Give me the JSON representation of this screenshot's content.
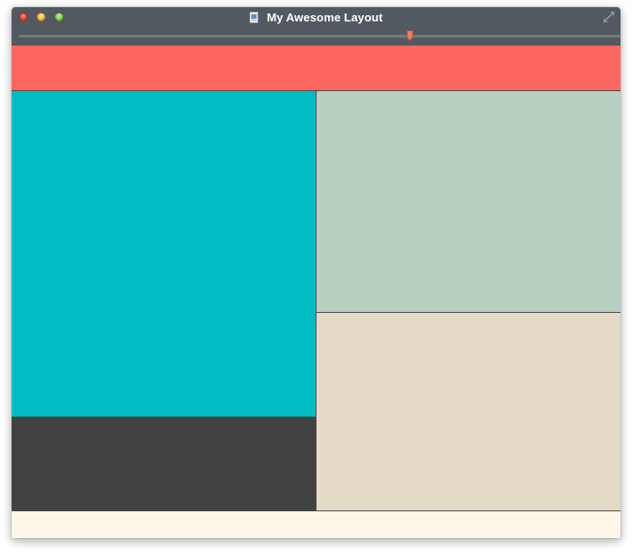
{
  "window": {
    "title": "My Awesome Layout",
    "titlebar_color": "#535961"
  },
  "controls": {
    "close_icon": "close-traffic-light",
    "minimize_icon": "minimize-traffic-light",
    "zoom_icon": "zoom-traffic-light",
    "fullscreen_icon": "fullscreen-arrows-icon",
    "document_icon": "document-proxy-icon"
  },
  "slider": {
    "value_fraction": 0.65,
    "thumb_color": "#f07d5f"
  },
  "panels": {
    "header": {
      "color": "#fd6760"
    },
    "left_top": {
      "color": "#00bec3"
    },
    "left_bottom": {
      "color": "#424242"
    },
    "right_top": {
      "color": "#b7d0bf"
    },
    "right_bottom": {
      "color": "#e4dbc9"
    },
    "footer": {
      "color": "#fff6ea"
    }
  }
}
